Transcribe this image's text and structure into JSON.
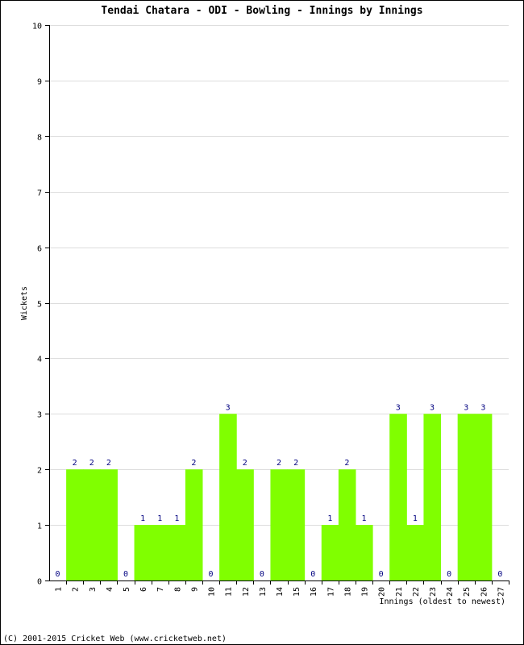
{
  "chart_data": {
    "type": "bar",
    "title": "Tendai Chatara - ODI - Bowling - Innings by Innings",
    "xlabel": "Innings (oldest to newest)",
    "ylabel": "Wickets",
    "ylim": [
      0,
      10
    ],
    "yticks": [
      0,
      1,
      2,
      3,
      4,
      5,
      6,
      7,
      8,
      9,
      10
    ],
    "grid": true,
    "categories": [
      "1",
      "2",
      "3",
      "4",
      "5",
      "6",
      "7",
      "8",
      "9",
      "10",
      "11",
      "12",
      "13",
      "14",
      "15",
      "16",
      "17",
      "18",
      "19",
      "20",
      "21",
      "22",
      "23",
      "24",
      "25",
      "26",
      "27"
    ],
    "values": [
      0,
      2,
      2,
      2,
      0,
      1,
      1,
      1,
      2,
      0,
      3,
      2,
      0,
      2,
      2,
      0,
      1,
      2,
      1,
      0,
      3,
      1,
      3,
      0,
      3,
      3,
      0
    ],
    "bar_color": "#80ff00",
    "label_color": "#000080",
    "grid_color": "#dddddd"
  },
  "footer": {
    "copyright": "(C) 2001-2015 Cricket Web (www.cricketweb.net)"
  }
}
